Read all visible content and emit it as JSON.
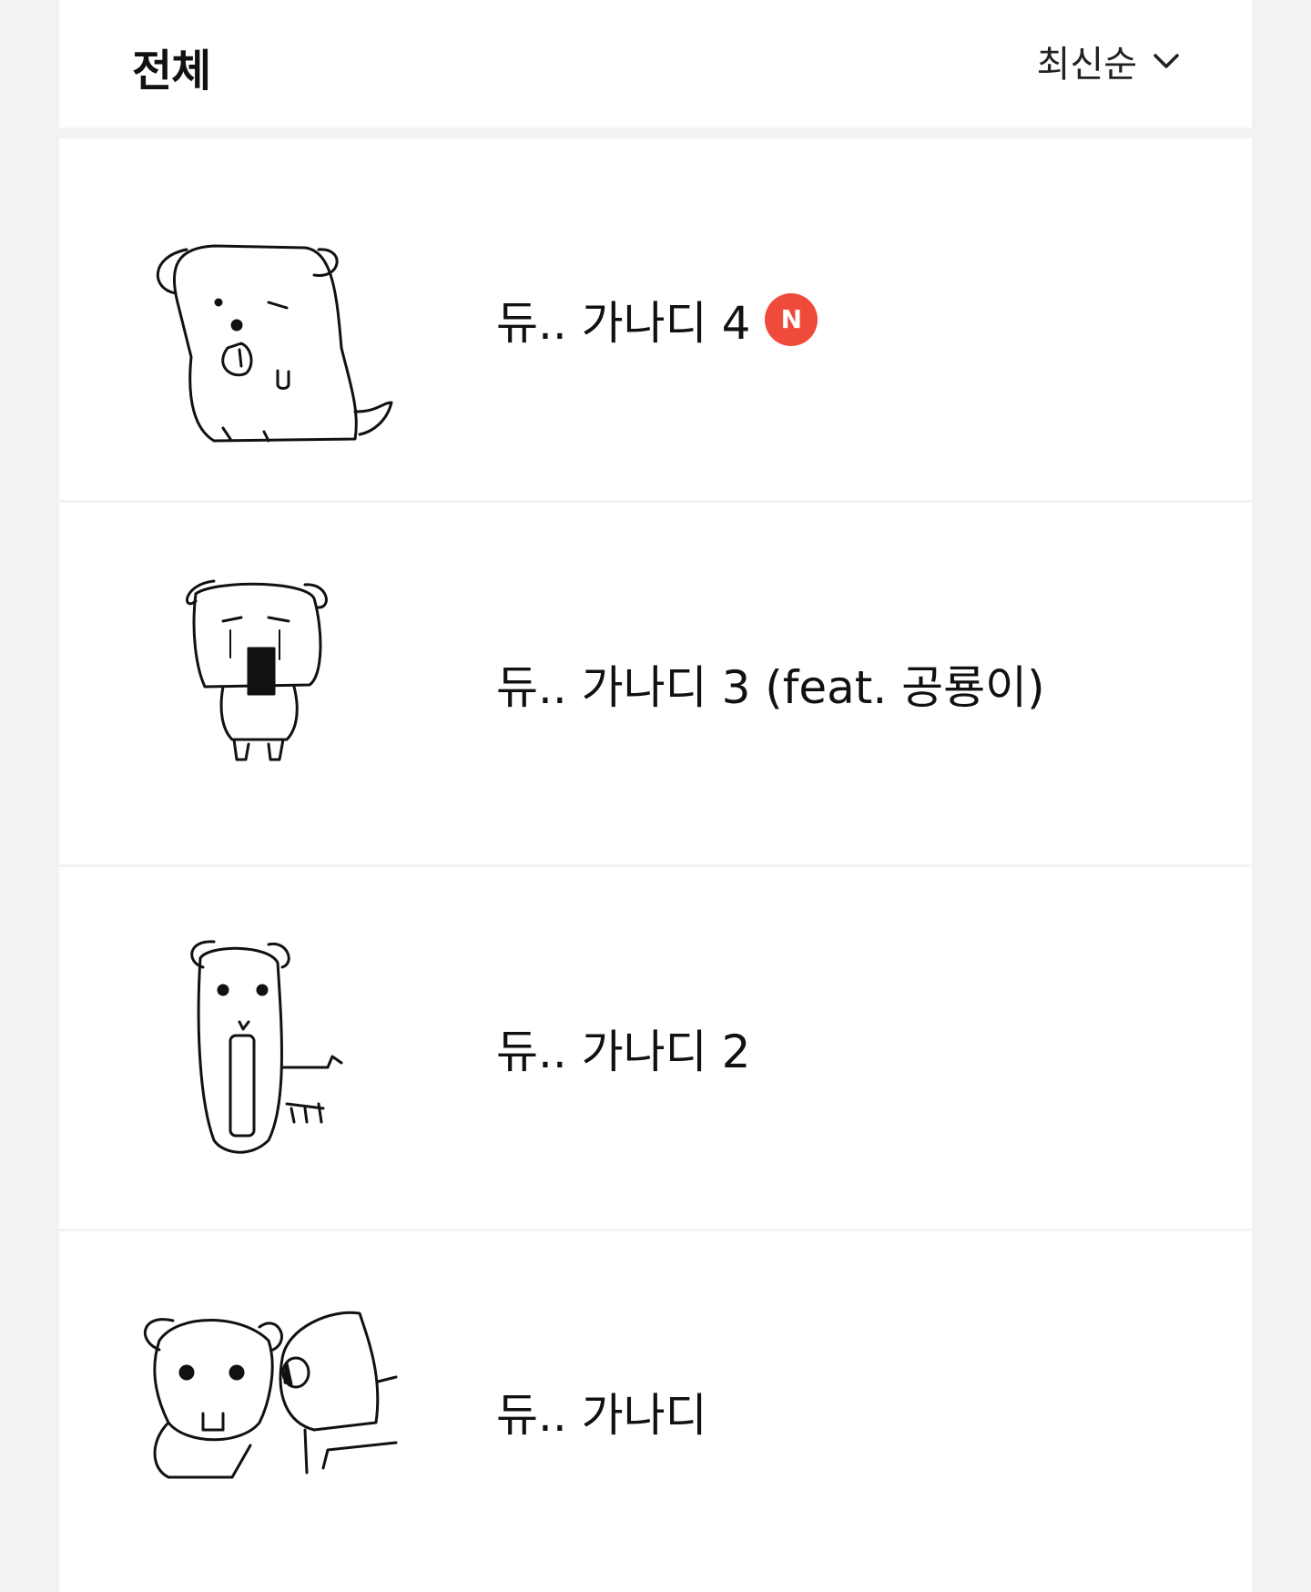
{
  "header": {
    "title": "전체",
    "sort_label": "최신순"
  },
  "items": [
    {
      "title": "듀.. 가나디 4",
      "badge": "N"
    },
    {
      "title": "듀.. 가나디 3 (feat. 공룡이)"
    },
    {
      "title": "듀.. 가나디 2"
    },
    {
      "title": "듀.. 가나디"
    }
  ]
}
